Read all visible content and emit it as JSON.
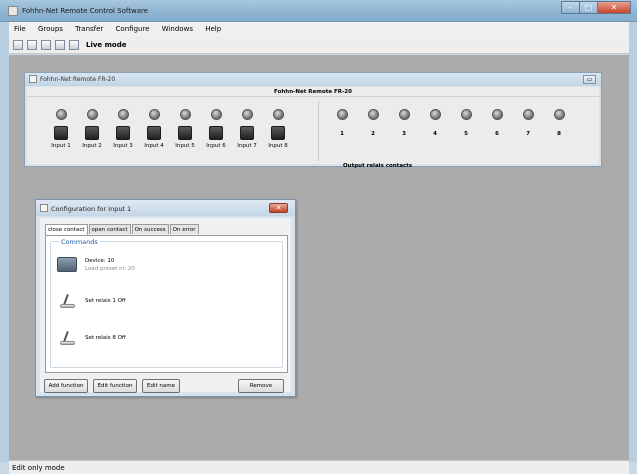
{
  "window": {
    "title": "Fohhn-Net Remote Control Software"
  },
  "menu": [
    "File",
    "Groups",
    "Transfer",
    "Configure",
    "Windows",
    "Help"
  ],
  "toolbar": {
    "icons": [
      "new-file-icon",
      "open-folder-icon",
      "upload-icon",
      "save-icon",
      "download-icon"
    ],
    "live_mode_label": "Live mode"
  },
  "device_window": {
    "title": "Fohhn-Net Remote FR-20",
    "header": "Fohhn-Net Remote FR-20",
    "inputs": [
      "Input 1",
      "Input 2",
      "Input 3",
      "Input 4",
      "Input 5",
      "Input 6",
      "Input 7",
      "Input 8"
    ],
    "outputs": [
      "1",
      "2",
      "3",
      "4",
      "5",
      "6",
      "7",
      "8"
    ],
    "output_caption": "Output relais contacts"
  },
  "config_dialog": {
    "title": "Configuration for Input 1",
    "tabs": [
      "close contact",
      "open contact",
      "On success",
      "On error"
    ],
    "active_tab": "close contact",
    "group_title": "Commands",
    "commands": [
      {
        "line1": "Device: 10",
        "line2": "Load preset nr. 20"
      },
      {
        "line1": "Set relais 1 Off"
      },
      {
        "line1": "Set relais 8 Off"
      }
    ],
    "buttons": {
      "add": "Add function",
      "edit": "Edit function",
      "edit_name": "Edit name",
      "remove": "Remove"
    }
  },
  "status": {
    "text": "Edit only mode"
  }
}
